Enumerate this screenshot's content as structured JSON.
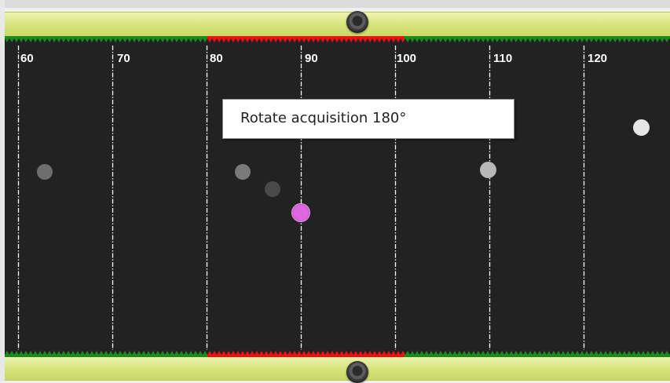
{
  "scale": {
    "labels": [
      "60",
      "70",
      "80",
      "90",
      "100",
      "110",
      "120"
    ]
  },
  "tooltip": {
    "text": "Rotate acquisition 180°"
  },
  "colors": {
    "background": "#222222",
    "rail": "#d6e37a",
    "rail_teeth_normal": "#1a8a1a",
    "rail_teeth_active": "#ee1111",
    "grid_line": "#ffffff",
    "marker_highlight": "#e066e0"
  },
  "markers": [
    {
      "name": "marker-gray-1",
      "color": "#6e6e6e"
    },
    {
      "name": "marker-gray-2",
      "color": "#7a7a7a"
    },
    {
      "name": "marker-dark",
      "color": "#4a4a4a"
    },
    {
      "name": "marker-selected",
      "color": "#e066e0"
    },
    {
      "name": "marker-light",
      "color": "#b8b8b8"
    },
    {
      "name": "marker-white",
      "color": "#e6e6e6"
    }
  ]
}
